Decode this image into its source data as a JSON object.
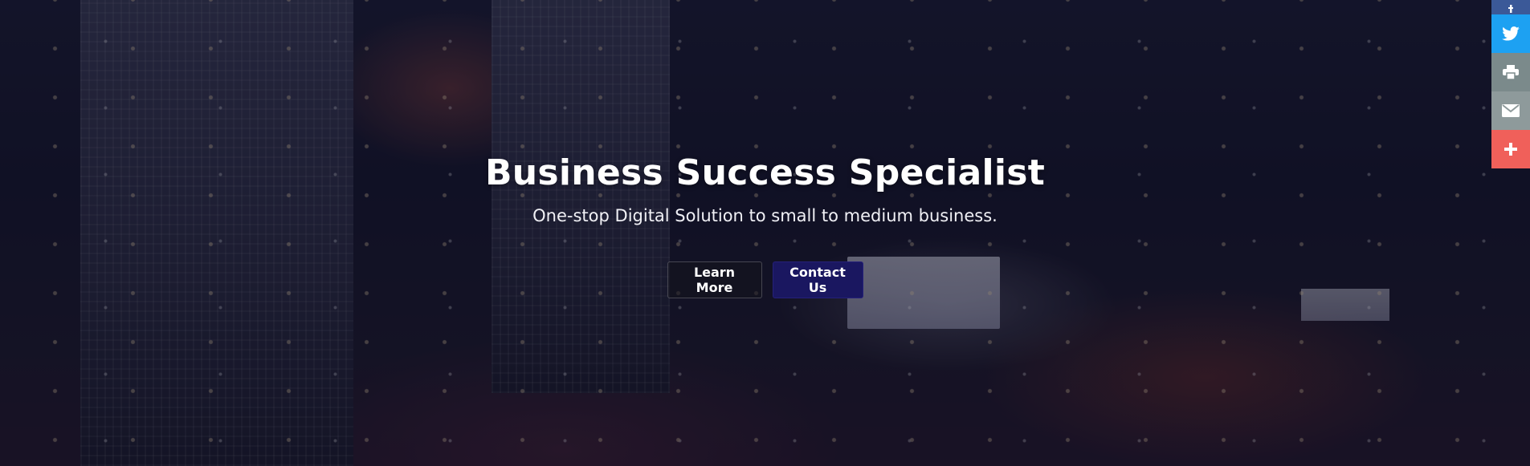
{
  "hero": {
    "title": "Business Success Specialist",
    "subtitle": "One-stop Digital Solution to small to medium business.",
    "buttons": {
      "learn_more": "Learn More",
      "contact_us": "Contact Us"
    }
  },
  "share_bar": {
    "items": [
      {
        "name": "facebook",
        "icon": "facebook-icon",
        "color": "#3b5998"
      },
      {
        "name": "twitter",
        "icon": "twitter-icon",
        "color": "#1da1f2"
      },
      {
        "name": "print",
        "icon": "print-icon",
        "color": "#7b8a8b"
      },
      {
        "name": "email",
        "icon": "email-icon",
        "color": "#8e9a9b"
      },
      {
        "name": "more",
        "icon": "plus-icon",
        "color": "#f0605a"
      }
    ]
  },
  "colors": {
    "primary_button": "#1a1760",
    "overlay": "#0a0c1e"
  }
}
